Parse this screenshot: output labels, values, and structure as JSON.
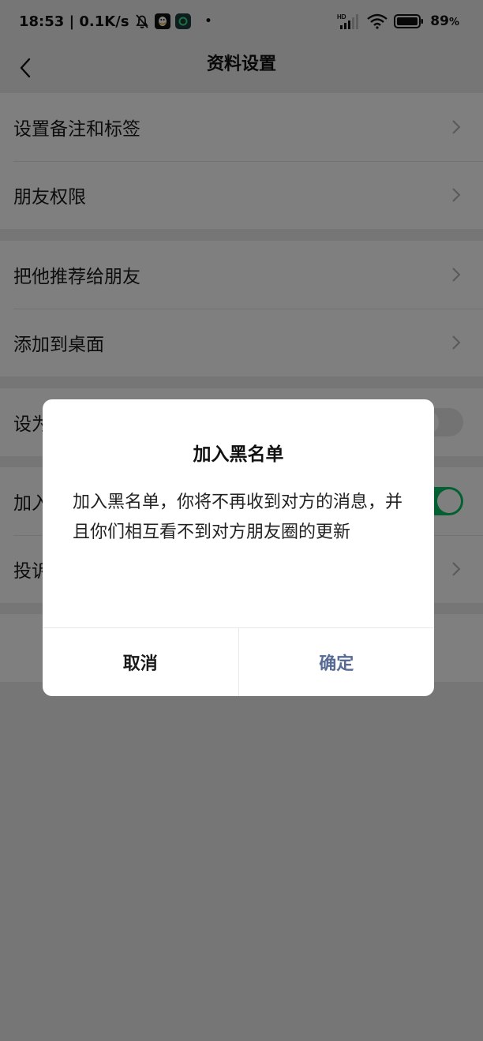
{
  "status_bar": {
    "time": "18:53",
    "network_speed": "0.1K/s",
    "battery": "89",
    "battery_unit": "%",
    "left_icons": [
      "bell-off-icon",
      "qq-icon",
      "app-icon"
    ],
    "right_icons": [
      "hd-signal-icon",
      "wifi-icon",
      "battery-icon"
    ],
    "signal_badge": "HD"
  },
  "nav": {
    "title": "资料设置",
    "back_icon": "chevron-left-icon"
  },
  "groups": [
    {
      "rows": [
        {
          "label": "设置备注和标签",
          "control": "chevron"
        },
        {
          "label": "朋友权限",
          "control": "chevron"
        }
      ]
    },
    {
      "rows": [
        {
          "label": "把他推荐给朋友",
          "control": "chevron"
        },
        {
          "label": "添加到桌面",
          "control": "chevron"
        }
      ]
    },
    {
      "rows": [
        {
          "label": "设为",
          "control": "toggle",
          "on": false
        }
      ]
    },
    {
      "rows": [
        {
          "label": "加入",
          "control": "toggle",
          "on": true
        },
        {
          "label": "投诉",
          "control": "chevron"
        }
      ]
    }
  ],
  "dialog": {
    "title": "加入黑名单",
    "message": "加入黑名单，你将不再收到对方的消息，并且你们相互看不到对方朋友圈的更新",
    "cancel_label": "取消",
    "confirm_label": "确定"
  },
  "colors": {
    "accent_green": "#07c160",
    "link_blue": "#576b95",
    "background": "#ededed"
  }
}
